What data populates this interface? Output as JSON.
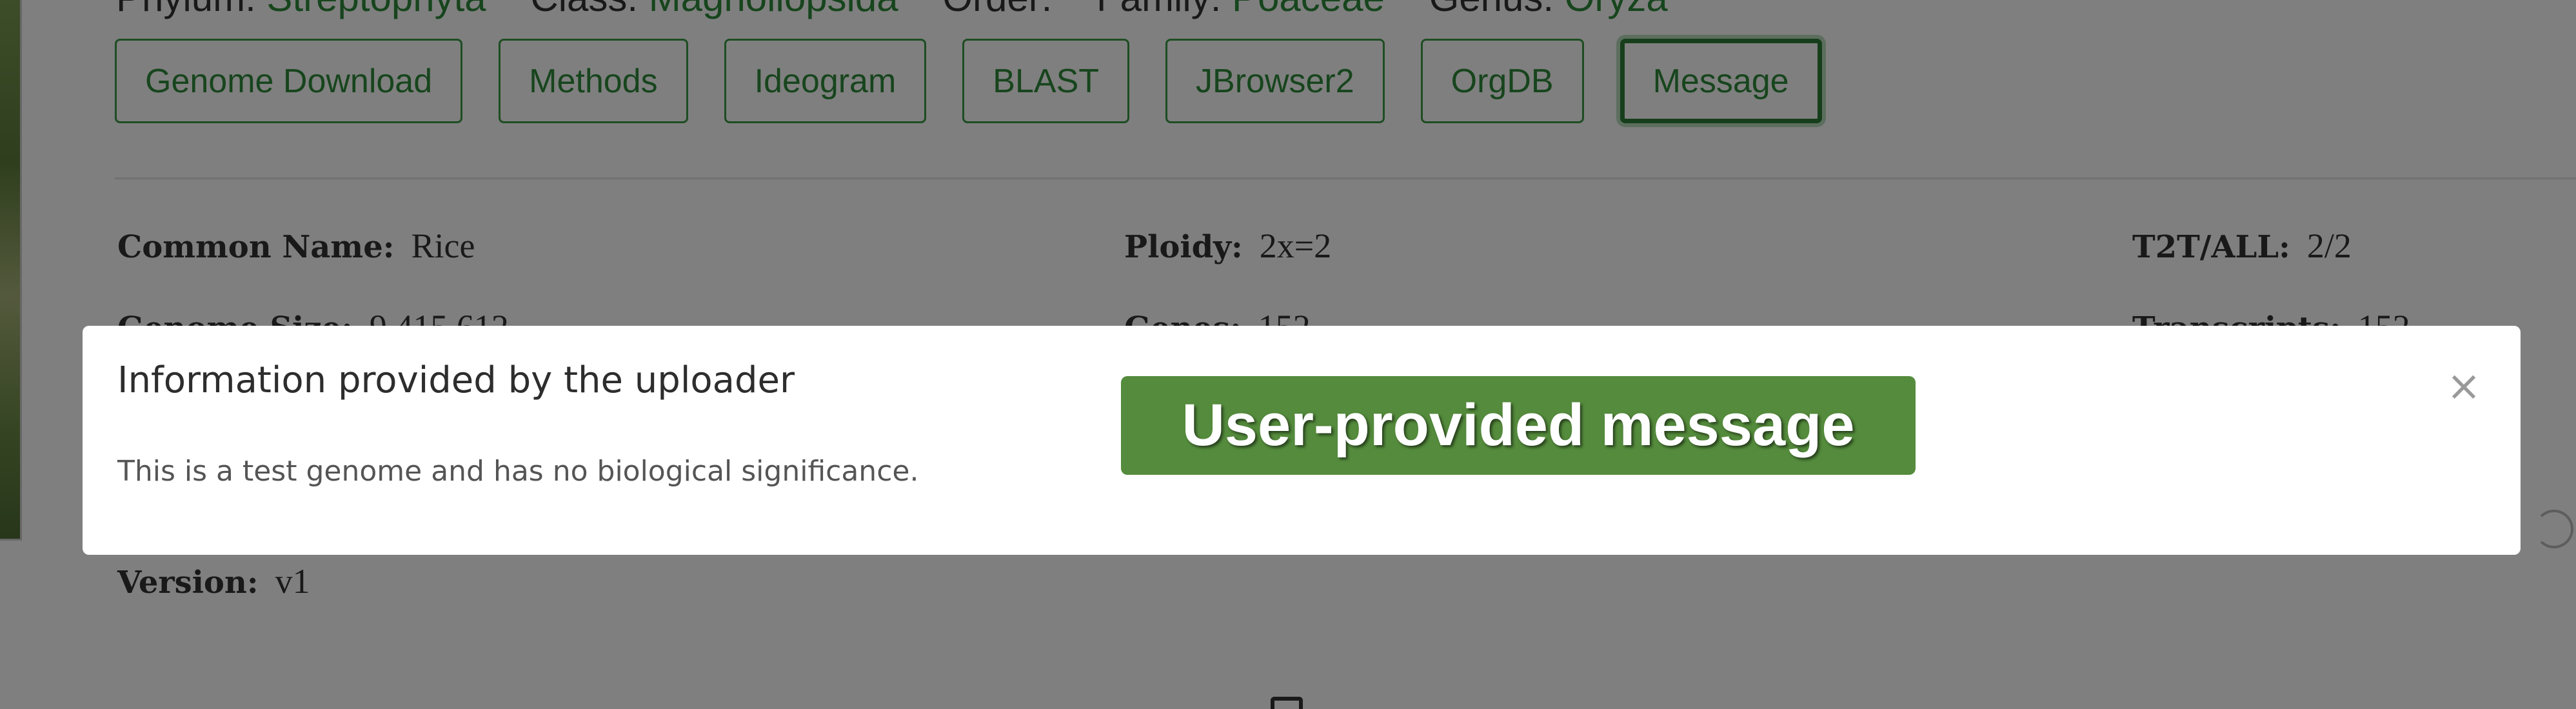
{
  "taxonomy": [
    {
      "label": "Phylum:",
      "value": "Streptophyta"
    },
    {
      "label": "Class:",
      "value": "Magnoliopsida"
    },
    {
      "label": "Order:",
      "value": ""
    },
    {
      "label": "Family:",
      "value": "Poaceae"
    },
    {
      "label": "Genus:",
      "value": "Oryza"
    }
  ],
  "buttons": [
    {
      "label": "Genome Download"
    },
    {
      "label": "Methods"
    },
    {
      "label": "Ideogram"
    },
    {
      "label": "BLAST"
    },
    {
      "label": "JBrowser2"
    },
    {
      "label": "OrgDB"
    },
    {
      "label": "Message",
      "active": true
    }
  ],
  "info": {
    "common_name": {
      "label": "Common Name:",
      "value": "Rice"
    },
    "ploidy": {
      "label": "Ploidy:",
      "value": "2x=2"
    },
    "t2t_all": {
      "label": "T2T/ALL:",
      "value": "2/2"
    },
    "genome_size": {
      "label": "Genome Size:",
      "value": "9,415,612"
    },
    "genes": {
      "label": "Genes:",
      "value": "152"
    },
    "transcripts": {
      "label": "Transcripts:",
      "value": "152"
    },
    "version": {
      "label": "Version:",
      "value": "v1"
    }
  },
  "modal": {
    "title": "Information provided by the uploader",
    "body": "This is a test genome and has no biological significance.",
    "close_symbol": "×"
  },
  "callout": {
    "text": "User-provided message"
  },
  "colors": {
    "accent": "#2e8b3a",
    "callout_bg": "#548b3c",
    "backdrop": "rgba(0,0,0,0.5)"
  }
}
